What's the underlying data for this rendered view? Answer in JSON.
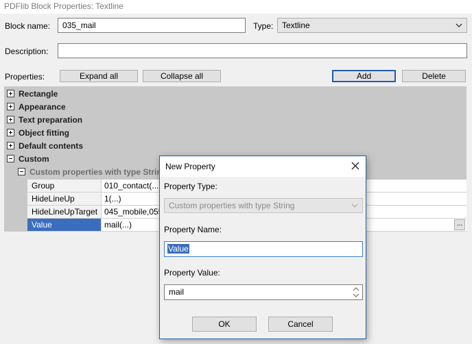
{
  "window": {
    "title": "PDFlib Block Properties: Textline"
  },
  "form": {
    "block_name_label": "Block name:",
    "block_name_value": "035_mail",
    "type_label": "Type:",
    "type_value": "Textline",
    "description_label": "Description:",
    "description_value": "",
    "properties_label": "Properties:"
  },
  "buttons": {
    "expand_all": "Expand all",
    "collapse_all": "Collapse all",
    "add": "Add",
    "delete": "Delete"
  },
  "tree": {
    "groups": [
      {
        "label": "Rectangle",
        "expanded": false
      },
      {
        "label": "Appearance",
        "expanded": false
      },
      {
        "label": "Text preparation",
        "expanded": false
      },
      {
        "label": "Object fitting",
        "expanded": false
      },
      {
        "label": "Default contents",
        "expanded": false
      },
      {
        "label": "Custom",
        "expanded": true
      }
    ],
    "subgroup": "Custom properties with type String",
    "properties": [
      {
        "name": "Group",
        "value": "010_contact(...)"
      },
      {
        "name": "HideLineUp",
        "value": "1(...)"
      },
      {
        "name": "HideLineUpTarget",
        "value": "045_mobile,055_p"
      },
      {
        "name": "Value",
        "value": "mail(...)",
        "selected": true
      }
    ],
    "ellipsis": "..."
  },
  "dialog": {
    "title": "New Property",
    "property_type_label": "Property Type:",
    "property_type_value": "Custom properties with type String",
    "property_name_label": "Property Name:",
    "property_name_value": "Value",
    "property_value_label": "Property Value:",
    "property_value_value": "mail",
    "ok": "OK",
    "cancel": "Cancel"
  },
  "colors": {
    "selection": "#3b6dbd",
    "focus_border": "#1f5fa8",
    "group_background": "#c8c8c8"
  }
}
